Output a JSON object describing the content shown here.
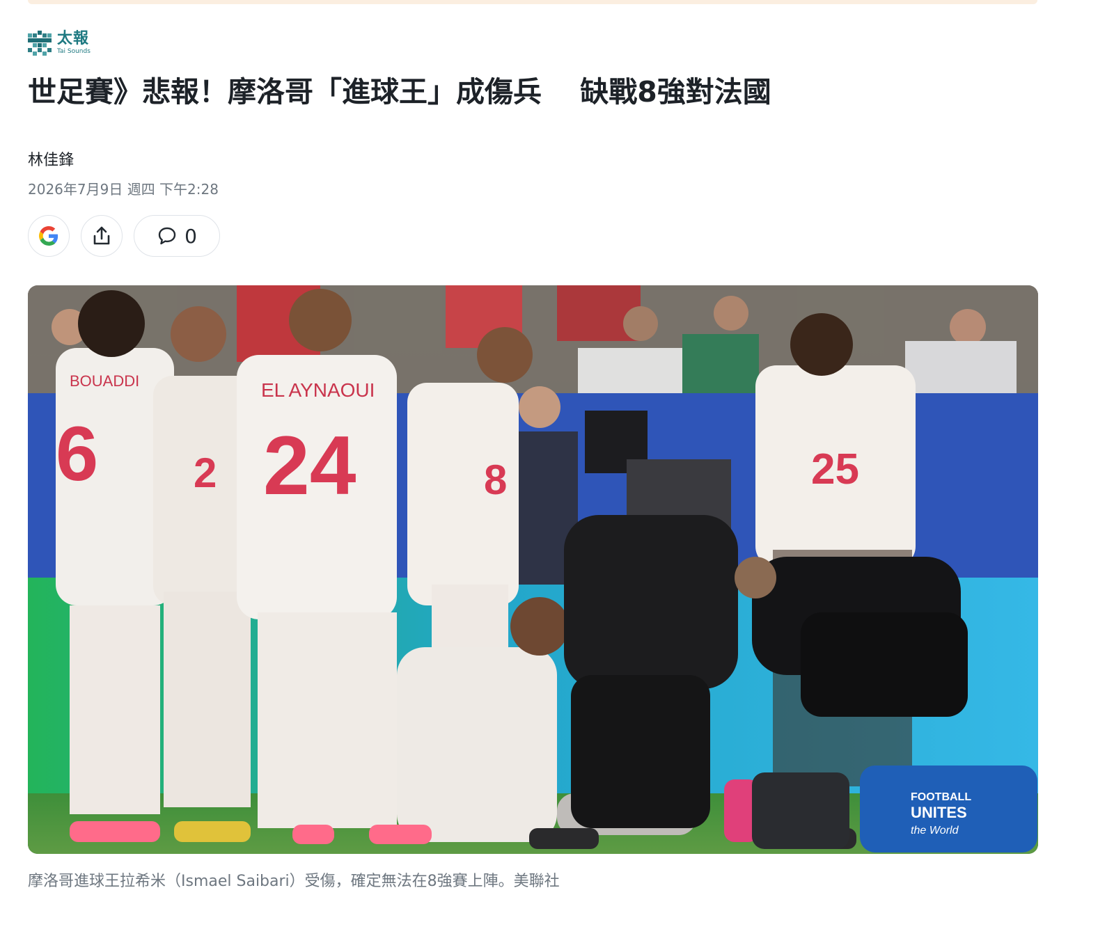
{
  "publisher": {
    "name": "太報",
    "subtitle": "Tai Sounds"
  },
  "article": {
    "headline": "世足賽》悲報！摩洛哥「進球王」成傷兵　 缺戰8強對法國",
    "author": "林佳鋒",
    "timestamp": "2026年7月9日 週四 下午2:28"
  },
  "actions": {
    "google_icon": "google-icon",
    "share_icon": "share-icon",
    "comment_icon": "comment-icon",
    "comment_count": "0"
  },
  "photo": {
    "jersey_names": [
      "BOUADDI",
      "EL AYNAOUI"
    ],
    "jersey_numbers": [
      "6",
      "2",
      "24",
      "8",
      "25"
    ],
    "bag_text": [
      "FOOTBALL",
      "UNITES",
      "the World"
    ]
  },
  "caption": "摩洛哥進球王拉希米（Ismael Saibari）受傷，確定無法在8強賽上陣。美聯社",
  "colors": {
    "accent": "#1f7a82",
    "text": "#1d2228",
    "muted": "#6e7780",
    "border": "#dfe3e8",
    "strip": "#fbeee0"
  }
}
